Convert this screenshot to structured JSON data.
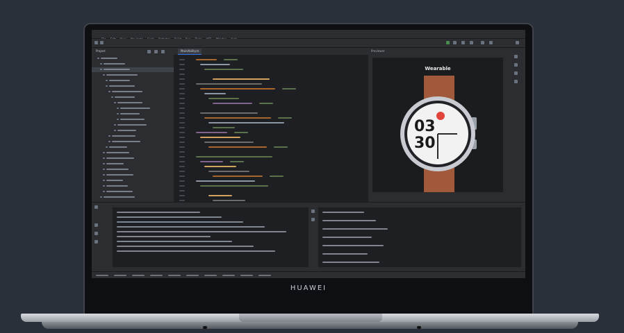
{
  "laptop": {
    "brand": "HUAWEI"
  },
  "ide": {
    "menu": [
      "File",
      "Edit",
      "View",
      "Navigate",
      "Code",
      "Refactor",
      "Build",
      "Run",
      "Tools",
      "VCS",
      "Window",
      "Help"
    ],
    "project_panel": {
      "title": "Project"
    },
    "editor_tab": {
      "label": "MainAbility.ts"
    },
    "preview_panel": {
      "title": "Previewer"
    },
    "watch": {
      "brand_label": "Wearable",
      "hour": "03",
      "minute": "30"
    }
  },
  "colors": {
    "accent": "#3574f0",
    "watch_red": "#e0443a",
    "strap": "#a0593a"
  }
}
